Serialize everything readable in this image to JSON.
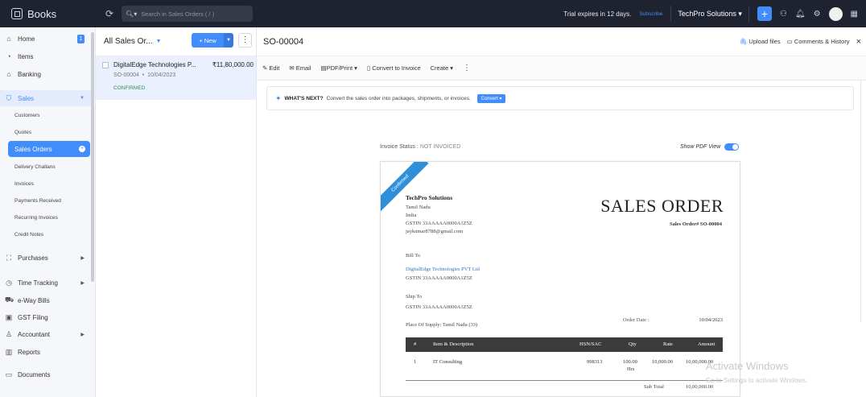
{
  "topbar": {
    "app_name": "Books",
    "search_placeholder": "Search in Sales Orders ( / )",
    "trial_text": "Trial expires in 12 days.",
    "subscribe": "Subscribe",
    "org_name": "TechPro Solutions"
  },
  "sidebar": {
    "home": "Home",
    "home_badge": "1",
    "items": "Items",
    "banking": "Banking",
    "sales": "Sales",
    "customers": "Customers",
    "quotes": "Quotes",
    "sales_orders": "Sales Orders",
    "delivery_challans": "Delivery Challans",
    "invoices": "Invoices",
    "payments_received": "Payments Received",
    "recurring_invoices": "Recurring Invoices",
    "credit_notes": "Credit Notes",
    "purchases": "Purchases",
    "time_tracking": "Time Tracking",
    "eway_bills": "e-Way Bills",
    "gst_filing": "GST Filing",
    "accountant": "Accountant",
    "reports": "Reports",
    "documents": "Documents"
  },
  "list": {
    "title": "All Sales Or...",
    "new_label": "+ New",
    "rows": [
      {
        "customer": "DigitalEdge Technologies P...",
        "amount": "₹11,80,000.00",
        "number": "SO-00004",
        "date": "10/04/2023",
        "status": "CONFIRMED"
      }
    ]
  },
  "detail": {
    "so_number": "SO-00004",
    "upload": "Upload files",
    "comments": "Comments & History",
    "toolbar": {
      "edit": "Edit",
      "email": "Email",
      "pdf": "PDF/Print",
      "convert_invoice": "Convert to Invoice",
      "create": "Create"
    },
    "whatsnext_label": "WHAT'S NEXT?",
    "whatsnext_text": "Convert the sales order into packages, shipments, or invoices.",
    "convert_btn": "Convert",
    "invoice_status_label": "Invoice Status :",
    "invoice_status_value": "NOT INVOICED",
    "show_pdf_view": "Show PDF View"
  },
  "document": {
    "ribbon": "Confirmed",
    "company": "TechPro Solutions",
    "state": "Tamil Nadu",
    "country": "India",
    "gstin": "GSTIN 33AAAAA0000A1Z5Z",
    "email": "jaykumar8788@gmail.com",
    "title": "SALES ORDER",
    "so_label": "Sales Order# SO-00004",
    "bill_to": "Bill To",
    "bill_name": "DigitalEdge Technologies PVT Ltd",
    "bill_gstin": "GSTIN 33AAAAA0000A1Z5Z",
    "ship_to": "Ship To",
    "ship_gstin": "GSTIN 33AAAAA0000A1Z5Z",
    "order_date_label": "Order Date :",
    "order_date": "10/04/2023",
    "place_of_supply": "Place Of Supply: Tamil Nadu (33)",
    "table_headers": [
      "#",
      "Item & Description",
      "HSN/SAC",
      "Qty",
      "Rate",
      "Amount"
    ],
    "table_rows": [
      {
        "num": "1",
        "item": "IT Consulting",
        "hsn": "998313",
        "qty": "100.00",
        "unit": "Hrs",
        "rate": "10,000.00",
        "amount": "10,00,000.00"
      }
    ],
    "subtotal_label": "Sub Total",
    "subtotal": "10,00,000.00"
  },
  "watermark": {
    "line1": "Activate Windows",
    "line2": "Go to Settings to activate Windows."
  }
}
